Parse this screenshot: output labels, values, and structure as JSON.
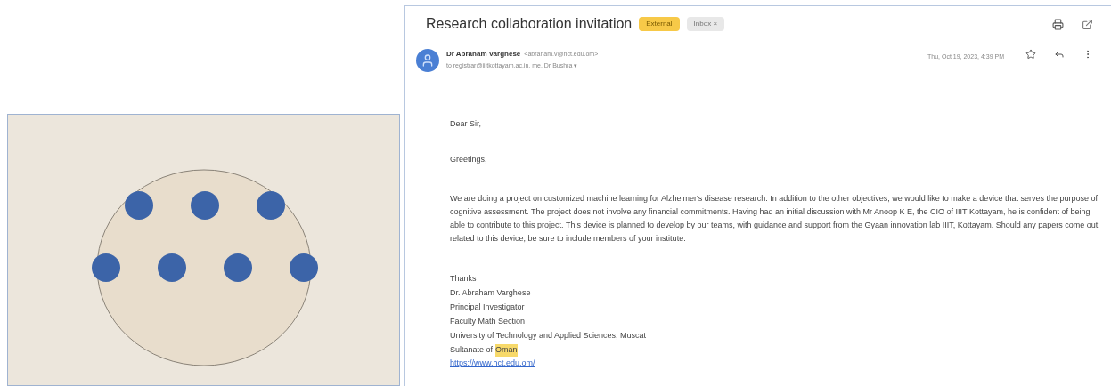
{
  "email": {
    "subject": "Research collaboration invitation",
    "labels": [
      {
        "text": "External",
        "kind": "external"
      },
      {
        "text": "Inbox ×",
        "kind": "folder"
      }
    ],
    "sender": {
      "name": "Dr Abraham Varghese",
      "address": "<abraham.v@hct.edu.om>",
      "recipients": "to registrar@iiitkottayam.ac.in, me, Dr Bushra ▾",
      "date": "Thu, Oct 19, 2023, 4:39 PM"
    },
    "body": {
      "greeting": "Dear Sir,",
      "salutation": "Greetings,",
      "paragraph": "We are doing a project on customized machine learning for Alzheimer's disease research. In addition to the other objectives, we would like to make a device that serves the purpose of cognitive assessment. The project does not involve any financial commitments. Having had an initial discussion with Mr Anoop K E, the CIO of IIIT Kottayam, he is confident of being able to contribute to this project. This device is planned to develop by our teams, with guidance and support from the Gyaan innovation lab IIIT, Kottayam. Should any papers come out related to this device, be sure to include members of your institute.",
      "signature": [
        [
          {
            "text": "Thanks",
            "highlighted": false
          }
        ],
        [
          {
            "text": "Dr. Abraham Varghese",
            "highlighted": false
          }
        ],
        [
          {
            "text": "Principal Investigator",
            "highlighted": false
          }
        ],
        [
          {
            "text": "Faculty Math Section",
            "highlighted": false
          }
        ],
        [
          {
            "text": "University of Technology and Applied Sciences, Muscat",
            "highlighted": false
          }
        ],
        [
          {
            "text": "Sultanate of",
            "highlighted": false
          },
          {
            "text": "Oman",
            "highlighted": true
          }
        ]
      ],
      "link": "https://www.hct.edu.om/"
    }
  }
}
